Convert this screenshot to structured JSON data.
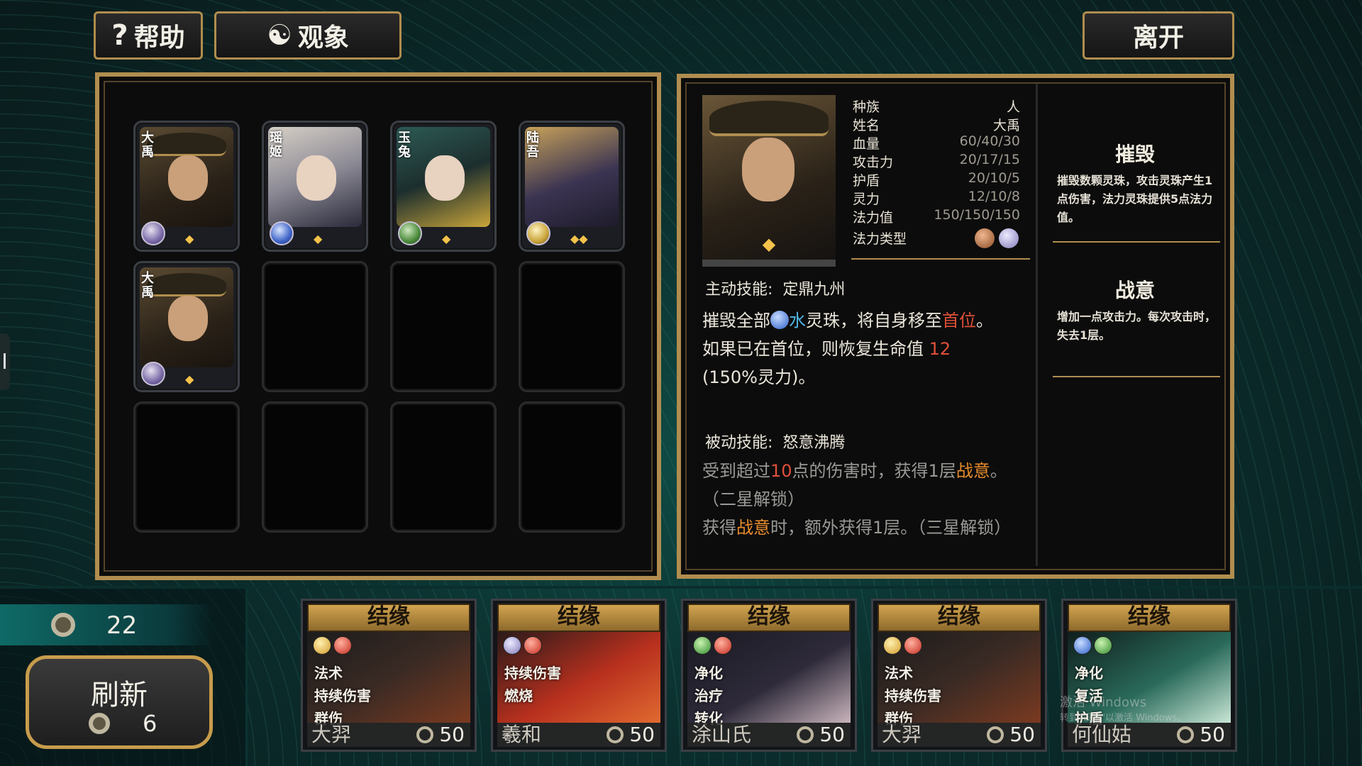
{
  "top_buttons": {
    "help": "帮助",
    "observe": "观象",
    "leave": "离开"
  },
  "roster": [
    {
      "name": "大禹",
      "stars": "◆",
      "orb": "purple"
    },
    {
      "name": "瑶姬",
      "stars": "◆",
      "orb": "blue"
    },
    {
      "name": "玉兔",
      "stars": "◆",
      "orb": "green"
    },
    {
      "name": "陆吾",
      "stars": "◆◆",
      "orb": "gold"
    },
    {
      "name": "大禹",
      "stars": "◆",
      "orb": "purple"
    }
  ],
  "detail": {
    "portrait_stars": "◆",
    "stats": [
      {
        "label": "种族",
        "value": "人"
      },
      {
        "label": "姓名",
        "value": "大禹"
      },
      {
        "label": "血量",
        "value": "60/40/30"
      },
      {
        "label": "攻击力",
        "value": "20/17/15"
      },
      {
        "label": "护盾",
        "value": "20/10/5"
      },
      {
        "label": "灵力",
        "value": "12/10/8"
      },
      {
        "label": "法力值",
        "value": "150/150/150"
      },
      {
        "label": "法力类型",
        "value": ""
      }
    ],
    "active_label": "主动技能:",
    "active_name": "定鼎九州",
    "active_desc": {
      "p1": "摧毁全部",
      "water": "水",
      "p2": "灵珠，将自身移至",
      "first": "首位",
      "p3": "。",
      "p4": "如果已在首位，则恢复生命值",
      "heal": "12",
      "p5": "(150%灵力)。"
    },
    "passive_label": "被动技能:",
    "passive_name": "怒意沸腾",
    "passive_desc": {
      "a1": "受到超过",
      "num": "10",
      "a2": "点的伤害时，获得1层",
      "rage": "战意",
      "a3": "。",
      "a4": "（二星解锁）",
      "b1": "获得",
      "rage2": "战意",
      "b2": "时，额外获得1层。（三星解锁）"
    }
  },
  "keywords": [
    {
      "title": "摧毁",
      "text": "摧毁数颗灵珠，攻击灵珠产生1点伤害，法力灵珠提供5点法力值。"
    },
    {
      "title": "战意",
      "text": "增加一点攻击力。每次攻击时，失去1层。"
    }
  ],
  "currency": "22",
  "refresh": {
    "label": "刷新",
    "cost": "6"
  },
  "shop": [
    {
      "header": "结缘",
      "name": "大羿",
      "price": "50",
      "orbs": [
        "gold",
        "red"
      ],
      "tags": [
        "法术",
        "持续伤害",
        "群伤"
      ]
    },
    {
      "header": "结缘",
      "name": "羲和",
      "price": "50",
      "orbs": [
        "purple",
        "red"
      ],
      "tags": [
        "持续伤害",
        "燃烧"
      ]
    },
    {
      "header": "结缘",
      "name": "涂山氏",
      "price": "50",
      "orbs": [
        "green",
        "red"
      ],
      "tags": [
        "净化",
        "治疗",
        "转化"
      ]
    },
    {
      "header": "结缘",
      "name": "大羿",
      "price": "50",
      "orbs": [
        "gold",
        "red"
      ],
      "tags": [
        "法术",
        "持续伤害",
        "群伤"
      ]
    },
    {
      "header": "结缘",
      "name": "何仙姑",
      "price": "50",
      "orbs": [
        "blue",
        "green"
      ],
      "tags": [
        "净化",
        "复活",
        "护盾"
      ]
    }
  ],
  "watermark": {
    "line1": "激活 Windows",
    "line2": "转到\"设置\"以激活 Windows。"
  }
}
